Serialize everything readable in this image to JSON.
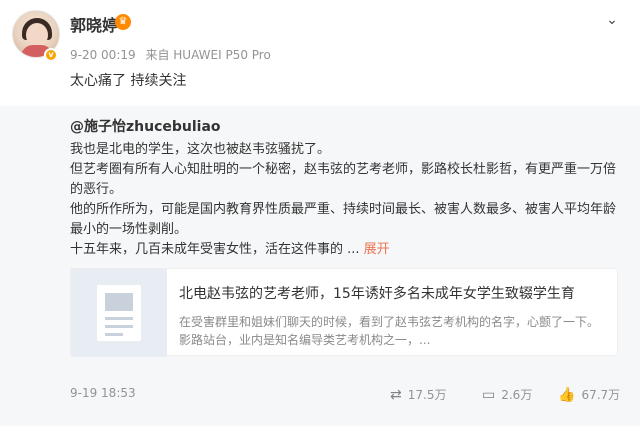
{
  "post": {
    "author_name": "郭晓婷",
    "verified_badge": "v",
    "crown_badge": "♛",
    "time": "9-20 00:19",
    "source": "来自 HUAWEI P50 Pro",
    "more_icon": "chevron-down-icon",
    "text": "太心痛了 持续关注"
  },
  "repost": {
    "author": "@施子怡zhucebuliao",
    "paragraphs": [
      "我也是北电的学生，这次也被赵韦弦骚扰了。",
      "但艺考圈有所有人心知肚明的一个秘密，赵韦弦的艺考老师，影路校长杜影哲，有更严重一万倍的恶行。",
      "他的所作所为，可能是国内教育界性质最严重、持续时间最长、被害人数最多、被害人平均年龄最小的一场性剥削。",
      "十五年来，几百未成年受害女性，活在这件事的 ..."
    ],
    "expand_label": "展开",
    "card": {
      "title": "北电赵韦弦的艺考老师，15年诱奸多名未成年女学生致辍学生育",
      "description": "在受害群里和姐妹们聊天的时候，看到了赵韦弦艺考机构的名字，心颤了一下。 影路站台，业内是知名编导类艺考机构之一，..."
    },
    "footer": {
      "date": "9-19 18:53",
      "repost_count": "17.5万",
      "comment_count": "2.6万",
      "like_count": "67.7万"
    }
  }
}
